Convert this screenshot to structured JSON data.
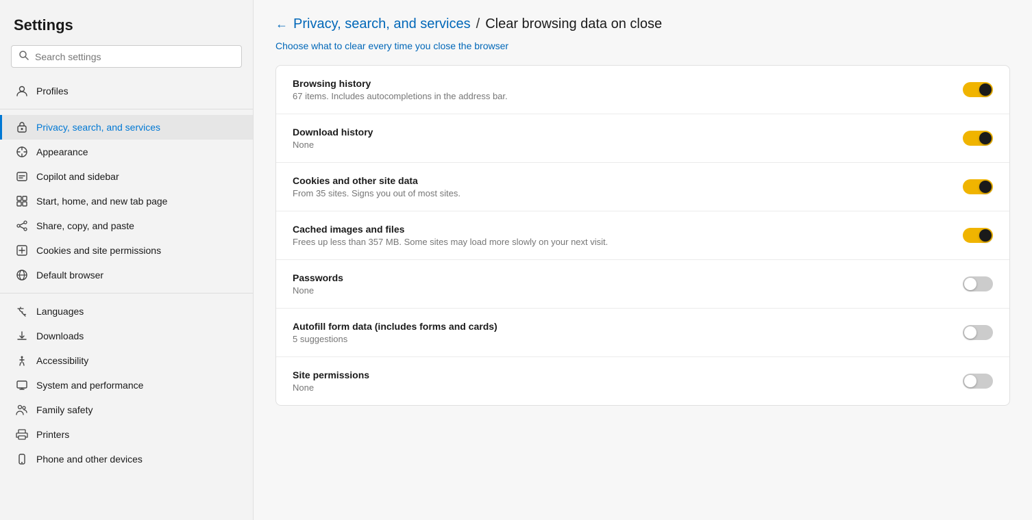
{
  "app": {
    "title": "Settings"
  },
  "sidebar": {
    "search_placeholder": "Search settings",
    "items": [
      {
        "id": "profiles",
        "label": "Profiles",
        "icon": "profile"
      },
      {
        "id": "privacy",
        "label": "Privacy, search, and services",
        "icon": "privacy",
        "active": true
      },
      {
        "id": "appearance",
        "label": "Appearance",
        "icon": "appearance"
      },
      {
        "id": "copilot",
        "label": "Copilot and sidebar",
        "icon": "copilot"
      },
      {
        "id": "start",
        "label": "Start, home, and new tab page",
        "icon": "start"
      },
      {
        "id": "share",
        "label": "Share, copy, and paste",
        "icon": "share"
      },
      {
        "id": "cookies",
        "label": "Cookies and site permissions",
        "icon": "cookies"
      },
      {
        "id": "default-browser",
        "label": "Default browser",
        "icon": "browser"
      },
      {
        "id": "languages",
        "label": "Languages",
        "icon": "language"
      },
      {
        "id": "downloads",
        "label": "Downloads",
        "icon": "download"
      },
      {
        "id": "accessibility",
        "label": "Accessibility",
        "icon": "accessibility"
      },
      {
        "id": "system",
        "label": "System and performance",
        "icon": "system"
      },
      {
        "id": "family",
        "label": "Family safety",
        "icon": "family"
      },
      {
        "id": "printers",
        "label": "Printers",
        "icon": "printer"
      },
      {
        "id": "phone",
        "label": "Phone and other devices",
        "icon": "phone"
      }
    ]
  },
  "breadcrumb": {
    "back_label": "←",
    "parent": "Privacy, search, and services",
    "separator": "/",
    "current": "Clear browsing data on close"
  },
  "subtitle": {
    "before": "Choose ",
    "link": "what to clear",
    "after": " every time you close the browser"
  },
  "settings": [
    {
      "id": "browsing-history",
      "title": "Browsing history",
      "desc": "67 items. Includes autocompletions in the address bar.",
      "enabled": true
    },
    {
      "id": "download-history",
      "title": "Download history",
      "desc": "None",
      "enabled": true
    },
    {
      "id": "cookies-site-data",
      "title": "Cookies and other site data",
      "desc": "From 35 sites. Signs you out of most sites.",
      "enabled": true
    },
    {
      "id": "cached-images",
      "title": "Cached images and files",
      "desc": "Frees up less than 357 MB. Some sites may load more slowly on your next visit.",
      "enabled": true
    },
    {
      "id": "passwords",
      "title": "Passwords",
      "desc": "None",
      "enabled": false
    },
    {
      "id": "autofill",
      "title": "Autofill form data (includes forms and cards)",
      "desc": "5 suggestions",
      "enabled": false
    },
    {
      "id": "site-permissions",
      "title": "Site permissions",
      "desc": "None",
      "enabled": false
    }
  ]
}
